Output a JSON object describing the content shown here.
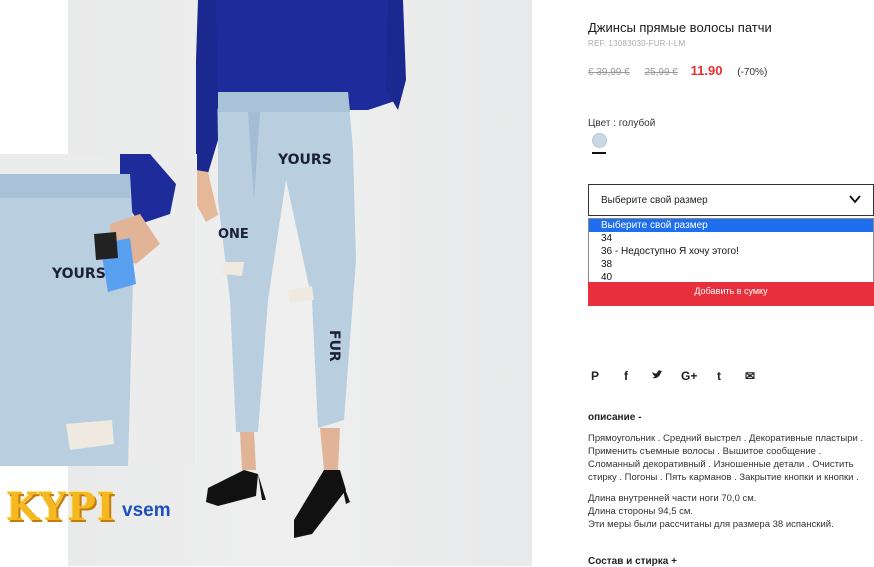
{
  "product": {
    "title": "Джинсы прямые волосы патчи",
    "ref": "REF. 13083030-FUR-I-LM",
    "price_old_1": "€ 39,99 €",
    "price_old_2": "25,99 €",
    "price_new": "11.90",
    "discount": "(-70%)"
  },
  "color": {
    "label": "Цвет : голубой",
    "swatch_color": "#c9d7e6"
  },
  "size_select": {
    "value": "Выберите свой размер",
    "options": [
      "Выберите свой размер",
      "34",
      "36 - Недоступно Я хочу этого!",
      "38",
      "40"
    ],
    "selected_index": 0
  },
  "add_to_bag": "Добавить в сумку",
  "social": [
    "P",
    "f",
    "t",
    "G+",
    "t",
    "✉"
  ],
  "description": {
    "heading": "описание -",
    "text": "Прямоугольник . Средний выстрел . Декоративные пластыри . Применить съемные волосы . Вышитое сообщение . Сломанный декоративный . Изношенные детали . Очистить стирку . Погоны . Пять карманов . Закрытие кнопки и кнопки .",
    "measures": [
      "Длина внутренней части ноги 70,0 см.",
      "Длина стороны 94,5 см.",
      "Эти меры были рассчитаны для размера 38 испанский."
    ]
  },
  "composition": "Состав и стирка +",
  "photo": {
    "patch_text_1": "YOURS",
    "patch_text_2": "ONE",
    "patch_text_3": "FUR",
    "thumb_patch": "YOURS"
  },
  "logo": {
    "part1": "KYPI",
    "part2": "vsem"
  },
  "colors": {
    "accent_red": "#e7303c",
    "price_red": "#e5302f",
    "select_blue": "#1e6ff0",
    "denim": "#b9cfe0"
  }
}
